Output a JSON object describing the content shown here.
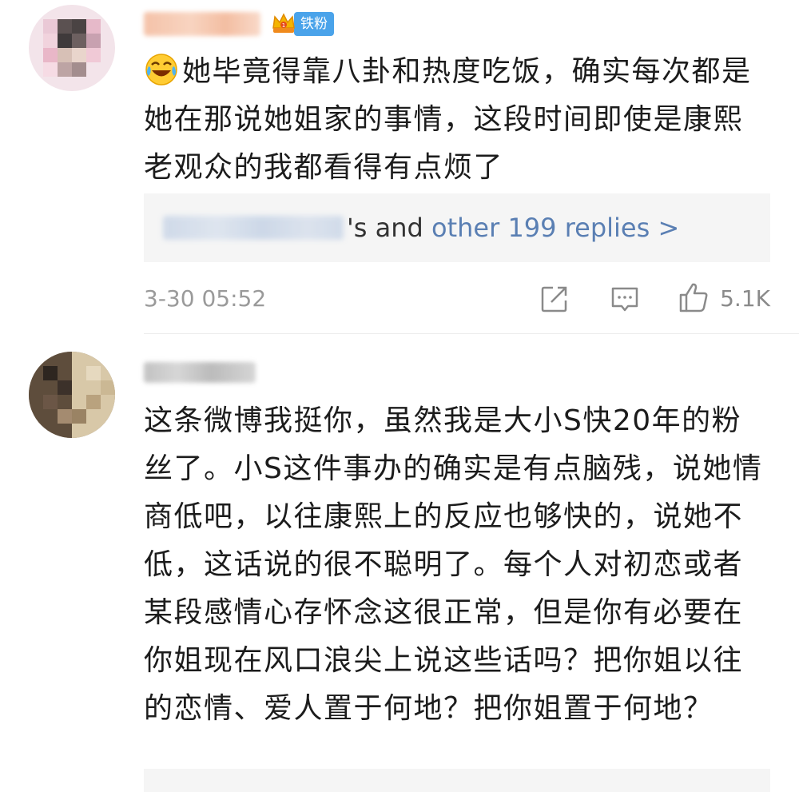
{
  "comments": [
    {
      "badge": "铁粉",
      "text": "她毕竟得靠八卦和热度吃饭，确实每次都是她在那说她姐家的事情，这段时间即使是康熙老观众的我都看得有点烦了",
      "replies": {
        "suffix": "'s and ",
        "link": "other 199 replies >"
      },
      "time": "3-30 05:52",
      "likes": "5.1K"
    },
    {
      "text": "这条微博我挺你，虽然我是大小S快20年的粉丝了。小S这件事办的确实是有点脑残，说她情商低吧，以往康熙上的反应也够快的，说她不低，这话说的很不聪明了。每个人对初恋或者某段感情心存怀念这很正常，但是你有必要在你姐现在风口浪尖上说这些话吗？把你姐以往的恋情、爱人置于何地？把你姐置于何地？"
    }
  ],
  "icons": {
    "emoji": "laugh-cry-emoji-icon",
    "crown": "crown-icon",
    "share": "share-icon",
    "comment": "comment-icon",
    "like": "thumbs-up-icon"
  },
  "colors": {
    "badge": "#4aa3ea",
    "link": "#5a7fb3",
    "meta": "#9a9a9a"
  }
}
